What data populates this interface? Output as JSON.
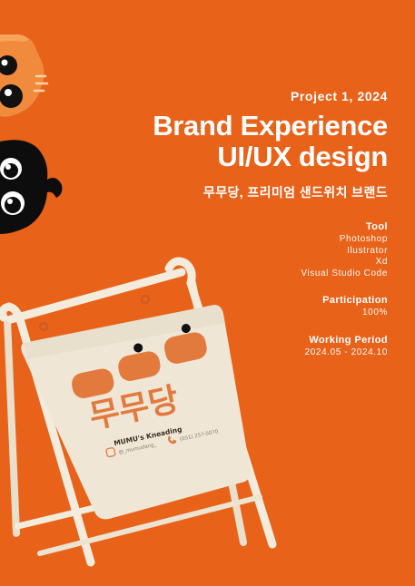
{
  "header": {
    "project": "Project 1, 2024",
    "title_line1": "Brand Experience",
    "title_line2": "UI/UX design",
    "subtitle": "무무당, 프리미엄 샌드위치 브랜드"
  },
  "tool": {
    "label": "Tool",
    "items": [
      "Photoshop",
      "Ilustrator",
      "Xd",
      "Visual Studio Code"
    ]
  },
  "participation": {
    "label": "Participation",
    "value": "100%"
  },
  "working_period": {
    "label": "Working Period",
    "value": "2024.05 - 2024.10"
  },
  "sign": {
    "logo": "무무당",
    "brand": "MUMU's Kneading",
    "instagram": "@_mumudang_",
    "phone": "(051) 257-0070"
  },
  "colors": {
    "background": "#e8621a",
    "text": "#ffffff",
    "sign_board": "#efe6d6",
    "sign_frame": "#f3ecdc",
    "logo_orange": "#e37a3d",
    "mascot_orange": "#f08a3c",
    "mascot_black": "#0d0d0d"
  },
  "icons": [
    "instagram-icon",
    "phone-icon",
    "orange-cat-mascot",
    "black-cat-mascot"
  ]
}
